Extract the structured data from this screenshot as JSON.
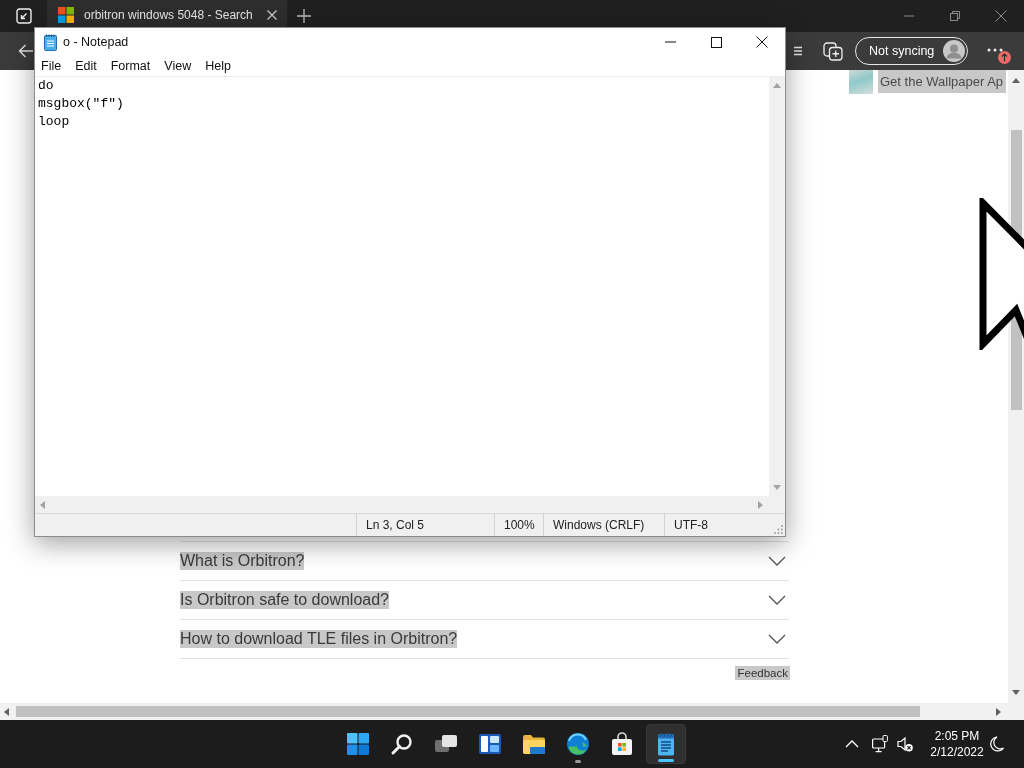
{
  "browser": {
    "tabs": [
      {
        "title": "orbitron windows 5048 - Search",
        "selected": true
      }
    ],
    "profile_button": "Not syncing"
  },
  "page": {
    "banner": {
      "text": "Get the Wallpaper Ap",
      "highlighted": true
    },
    "faq": [
      {
        "question": "What is Orbitron?",
        "expanded": false,
        "highlighted": true
      },
      {
        "question": "Is Orbitron safe to download?",
        "expanded": false,
        "highlighted": true
      },
      {
        "question": "How to download TLE files in Orbitron?",
        "expanded": false,
        "highlighted": true
      }
    ],
    "feedback": {
      "label": "Feedback",
      "highlighted": true
    }
  },
  "notepad": {
    "title": "o - Notepad",
    "menu": [
      "File",
      "Edit",
      "Format",
      "View",
      "Help"
    ],
    "lines": [
      "do",
      "msgbox(\"f\")",
      "loop"
    ],
    "status_bar": [
      "Ln 3, Col 5",
      "100%",
      "Windows (CRLF)",
      "UTF-8"
    ]
  },
  "taskbar": {
    "apps": [
      {
        "kind": "start",
        "running": false,
        "selected": false
      },
      {
        "kind": "search",
        "running": false,
        "selected": false
      },
      {
        "kind": "task_view",
        "running": false,
        "selected": false
      },
      {
        "kind": "widgets",
        "running": false,
        "selected": false
      },
      {
        "kind": "file_explorer",
        "running": false,
        "selected": false
      },
      {
        "kind": "edge",
        "running": true,
        "selected": false
      },
      {
        "kind": "store",
        "running": false,
        "selected": false
      },
      {
        "kind": "notepad",
        "running": true,
        "selected": true
      }
    ],
    "time": "2:05 PM",
    "date": "2/12/2022"
  }
}
